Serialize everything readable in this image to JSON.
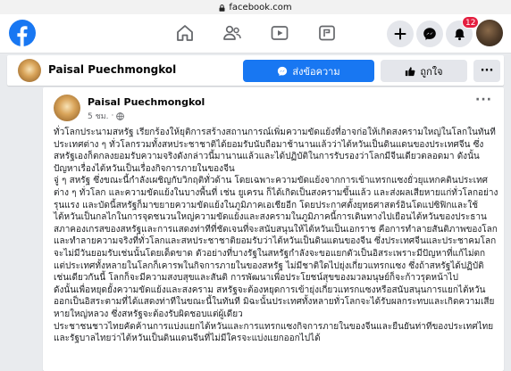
{
  "browser": {
    "url": "facebook.com"
  },
  "topnav": {
    "notification_count": "12",
    "icons": [
      "facebook-logo",
      "home-icon",
      "friends-icon",
      "watch-icon",
      "pages-icon",
      "plus-icon",
      "messenger-icon",
      "bell-icon",
      "avatar"
    ]
  },
  "page_header": {
    "name": "Paisal Puechmongkol",
    "message_label": "ส่งข้อความ",
    "like_label": "ถูกใจ",
    "more_label": "···"
  },
  "post": {
    "author": "Paisal Puechmongkol",
    "time": "5 ชม.",
    "more_label": "···",
    "paragraphs": [
      "ทั่วโลกประนามสหรัฐ เรียกร้องให้ยุติการสร้างสถานการณ์เพิ่มความขัดแย้งที่อาจก่อให้เกิดสงครามใหญ่ในโลกในทันที",
      "ประเทศต่าง ๆ ทั่วโลกรวมทั้งสหประชาชาติได้ยอมรับนับถือมาช้านานแล้วว่าไต้หวันเป็นดินแดนของประเทศจีน ซึ่งสหรัฐเองก็ตกลงยอมรับความจริงดังกล่าวนี้มานานแล้วและได้ปฏิบัติในการรับรองว่าโลกมีจีนเดียวตลอดมา ดังนั้นปัญหาเรื่องไต้หวันเป็นเรื่องกิจการภายในของจีน",
      "จู่ ๆ สหรัฐ ซึ่งขณะนี้กำลังเผชิญกับวิกฤติทั่วด้าน โดยเฉพาะความขัดแย้งจากการเข้าแทรกแซงยั่วยุแหกคตินประเทศต่าง ๆ ทั่วโลก และความขัดแย้งในบางพื้นที่ เช่น ยูเครน ก็ได้เกิดเป็นสงครามขึ้นแล้ว และส่งผลเสียหายแก่ทั่วโลกอย่างรุนแรง และบัดนี้สหรัฐก็มาขยายความขัดแย้งในภูมิภาคเอเชียอีก โดยประกาศตั้งยุทธศาสตร์อินโดแปซิฟิกและใช้ไต้หวันเป็นกลไกในการจุดชนวนใหญ่ความขัดแย้งและสงครามในภูมิภาคนี้การเดินทางไปเยือนไต้หวันของประธานสภาคองเกรสของสหรัฐและการแสดงท่าทีที่ชัดเจนที่จะสนับสนุนให้ไต้หวันเป็นเอกราช คือการทำลายสันติภาพของโลกและทำลายความจริงที่ทั่วโลกและสหประชาชาติยอมรับว่าไต้หวันเป็นดินแดนของจีน ซึ่งประเทศจีนและประชาคมโลกจะไม่มีวันยอมรับเช่นนั้นโดยเด็ดขาด ตัวอย่างที่บางรัฐในสหรัฐกำลังจะขอแยกตัวเป็นอิสระเพราะมีปัญหาที่แก้ไม่ตก แต่ประเทศทั้งหลายในโลกก็เคารพในกิจการภายในของสหรัฐ ไม่มีชาติใดไปยุ่งเกี่ยวแทรกแซง ซึ่งถ้าสหรัฐได้ปฏิบัติเช่นเดียวกันนี้ โลกก็จะมีความสงบสุขและสันติ การพัฒนาเพื่อประโยชน์สุขของมวลมนุษย์ก็จะก้าวรุดหน้าไป",
      "ดังนั้นเพื่อหยุดยั้งความขัดแย้งและสงคราม สหรัฐจะต้องหยุดการเข้ายุ่งเกี่ยวแทรกแซงหรือสนับสนุนการแยกไต้หวันออกเป็นอิสระตามที่ได้แสดงท่าทีในขณะนี้ในทันที มิฉะนั้นประเทศทั้งหลายทั่วโลกจะได้รับผลกระทบและเกิดความเสียหายใหญ่หลวง ซึ่งสหรัฐจะต้องรับผิดชอบแต่ผู้เดียว",
      "ประชาชนชาวไทยคัดค้านการแบ่งแยกไต้หวันและการแทรกแซงกิจการภายในของจีนและยืนยันท่าทีของประเทศไทยและรัฐบาลไทยว่าไต้หวันเป็นดินแดนจีนที่ไม่มีใครจะแบ่งแยกออกไปได้"
    ]
  },
  "colors": {
    "brand_blue": "#1877f2",
    "badge_red": "#e41e3f",
    "background": "#e9ebee",
    "button_grey": "#e4e6eb"
  }
}
